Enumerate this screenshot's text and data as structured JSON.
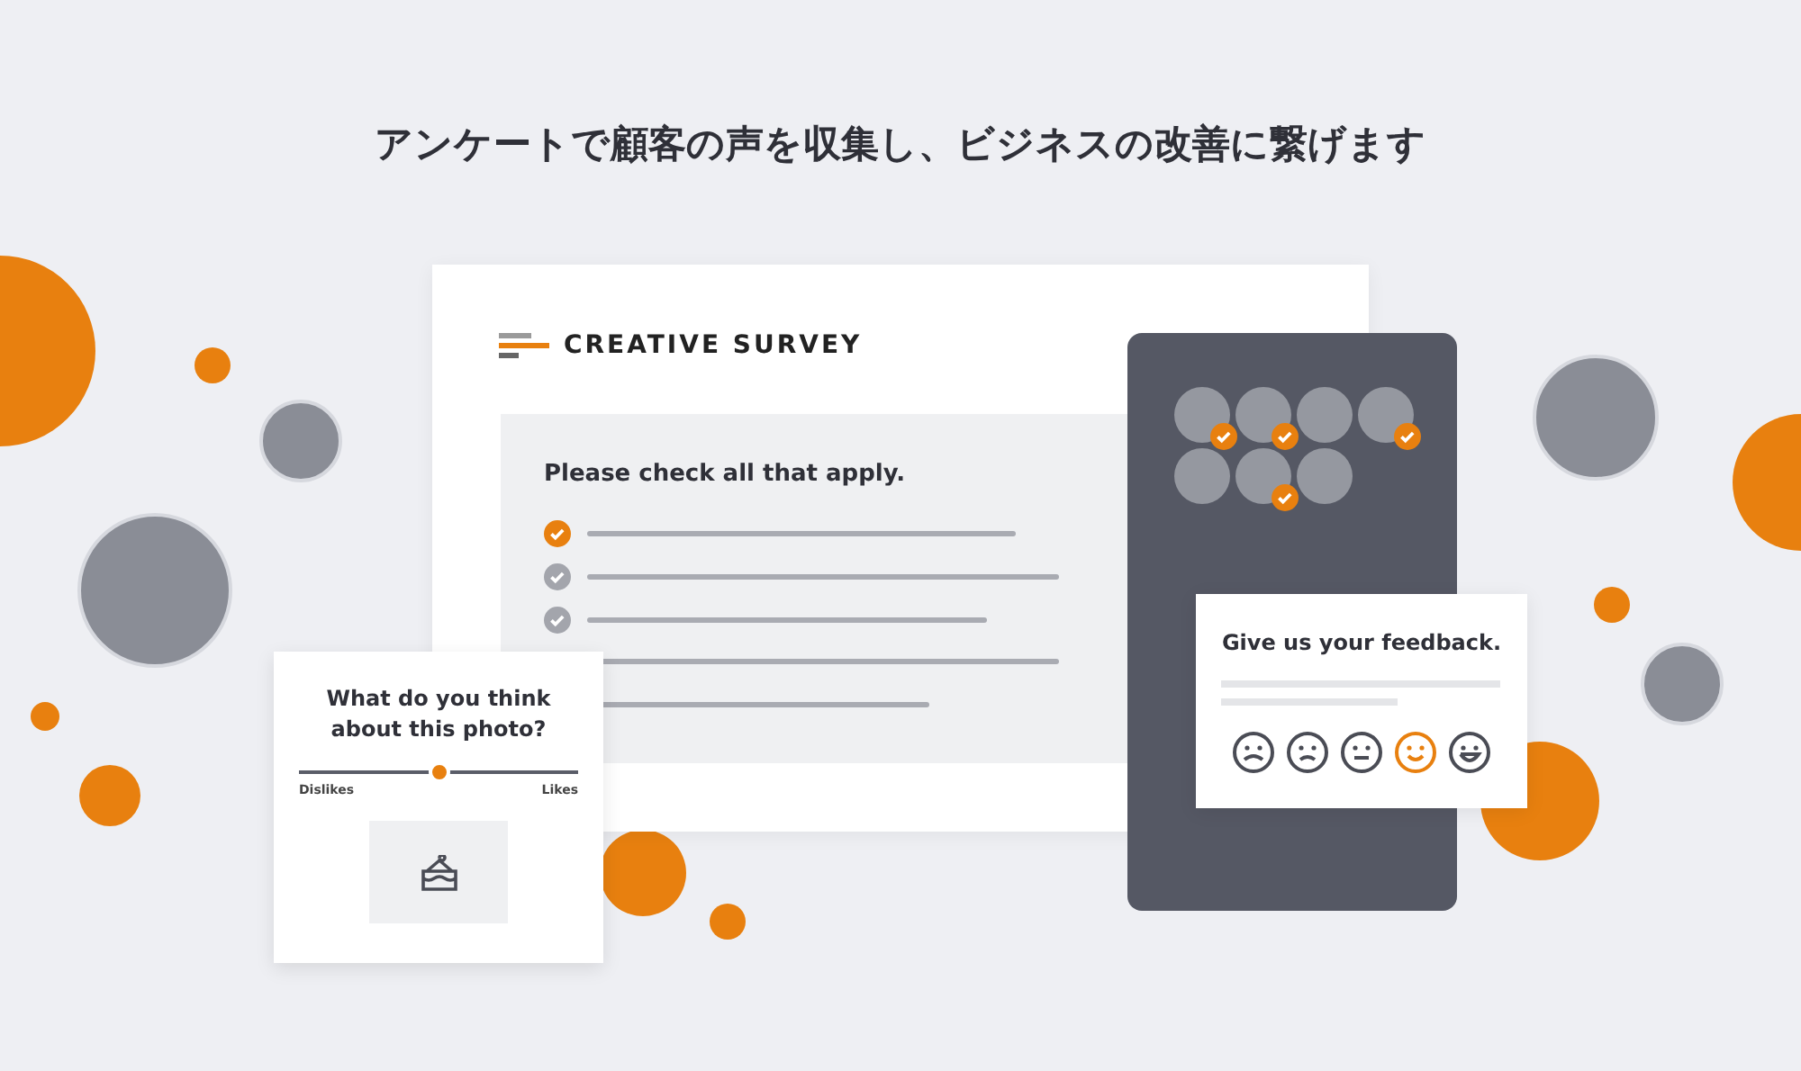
{
  "headline": "アンケートで顧客の声を収集し、ビジネスの改善に繋げます",
  "survey_card": {
    "brand": "CREATIVE SURVEY",
    "question": "Please check all that apply.",
    "options": [
      {
        "checked": true
      },
      {
        "checked": false
      },
      {
        "checked": false
      }
    ]
  },
  "respondents": [
    {
      "checked": true
    },
    {
      "checked": true
    },
    {
      "checked": false
    },
    {
      "checked": true
    },
    {
      "checked": false
    },
    {
      "checked": true
    },
    {
      "checked": false
    }
  ],
  "feedback_card": {
    "title": "Give us your feedback.",
    "faces": [
      {
        "kind": "very-sad",
        "selected": false
      },
      {
        "kind": "sad",
        "selected": false
      },
      {
        "kind": "neutral",
        "selected": false
      },
      {
        "kind": "smile",
        "selected": true
      },
      {
        "kind": "laugh",
        "selected": false
      }
    ]
  },
  "photo_card": {
    "question": "What do you think about this photo?",
    "slider": {
      "level": 0.5
    },
    "min_label": "Dislikes",
    "max_label": "Likes"
  }
}
